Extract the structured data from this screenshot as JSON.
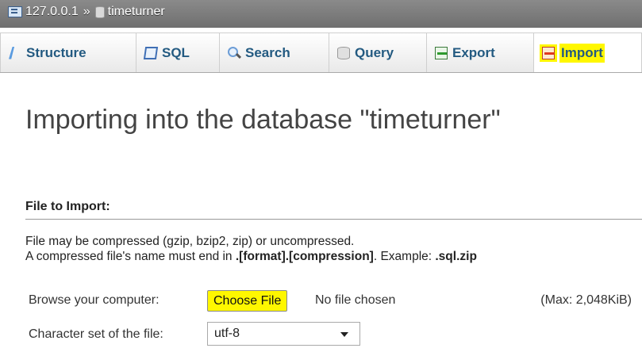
{
  "breadcrumb": {
    "server": "127.0.0.1",
    "separator": "»",
    "database": "timeturner"
  },
  "tabs": [
    {
      "label": "Structure",
      "icon": "structure-icon"
    },
    {
      "label": "SQL",
      "icon": "sql-icon"
    },
    {
      "label": "Search",
      "icon": "search-icon"
    },
    {
      "label": "Query",
      "icon": "query-icon"
    },
    {
      "label": "Export",
      "icon": "export-icon"
    },
    {
      "label": "Import",
      "icon": "import-icon",
      "active": true
    }
  ],
  "page": {
    "title": "Importing into the database \"timeturner\""
  },
  "file_import": {
    "legend": "File to Import:",
    "note_line1": "File may be compressed (gzip, bzip2, zip) or uncompressed.",
    "note_line2_prefix": "A compressed file's name must end in ",
    "note_line2_format": ".[format].[compression]",
    "note_line2_mid": ". Example: ",
    "note_line2_example": ".sql.zip",
    "browse_label": "Browse your computer:",
    "choose_file_label": "Choose File",
    "no_file_text": "No file chosen",
    "max_size": "(Max: 2,048KiB)",
    "charset_label": "Character set of the file:",
    "charset_value": "utf-8"
  },
  "colors": {
    "highlight": "#fff700",
    "tab_text": "#235a81",
    "breadcrumb_bg": "#7d7d7d"
  }
}
